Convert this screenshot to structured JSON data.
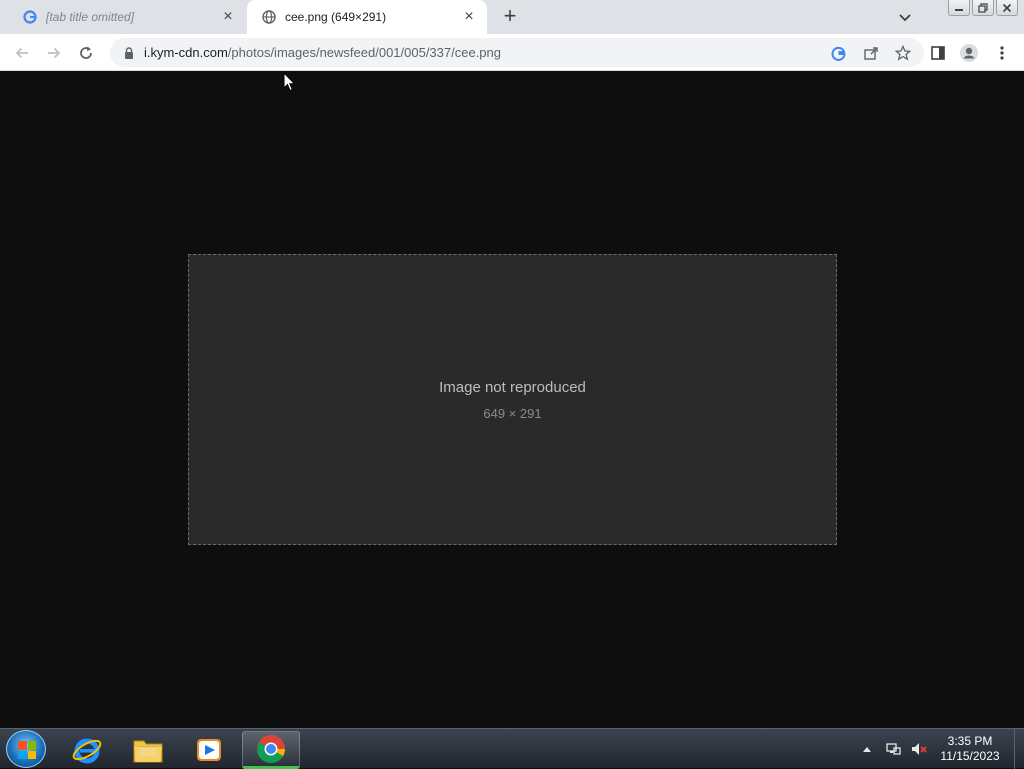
{
  "browser": {
    "tabs": [
      {
        "title": "[tab title omitted]",
        "active": false,
        "favicon": "google-g-icon"
      },
      {
        "title": "cee.png (649×291)",
        "active": true,
        "favicon": "globe-icon"
      }
    ],
    "new_tab": "+",
    "tab_close": "×",
    "url": {
      "host": "i.kym-cdn.com",
      "path": "/photos/images/newsfeed/001/005/337/cee.png"
    }
  },
  "viewport": {
    "image_placeholder_label": "Image not reproduced",
    "image_size": "649 × 291"
  },
  "taskbar": {
    "time": "3:35 PM",
    "date": "11/15/2023",
    "pinned": [
      "internet-explorer-icon",
      "file-explorer-icon",
      "media-player-icon",
      "chrome-icon"
    ]
  },
  "colors": {
    "tab_strip": "#dee1e6",
    "viewport": "#0e0e0e",
    "taskbar_active": "#3fc24f"
  }
}
